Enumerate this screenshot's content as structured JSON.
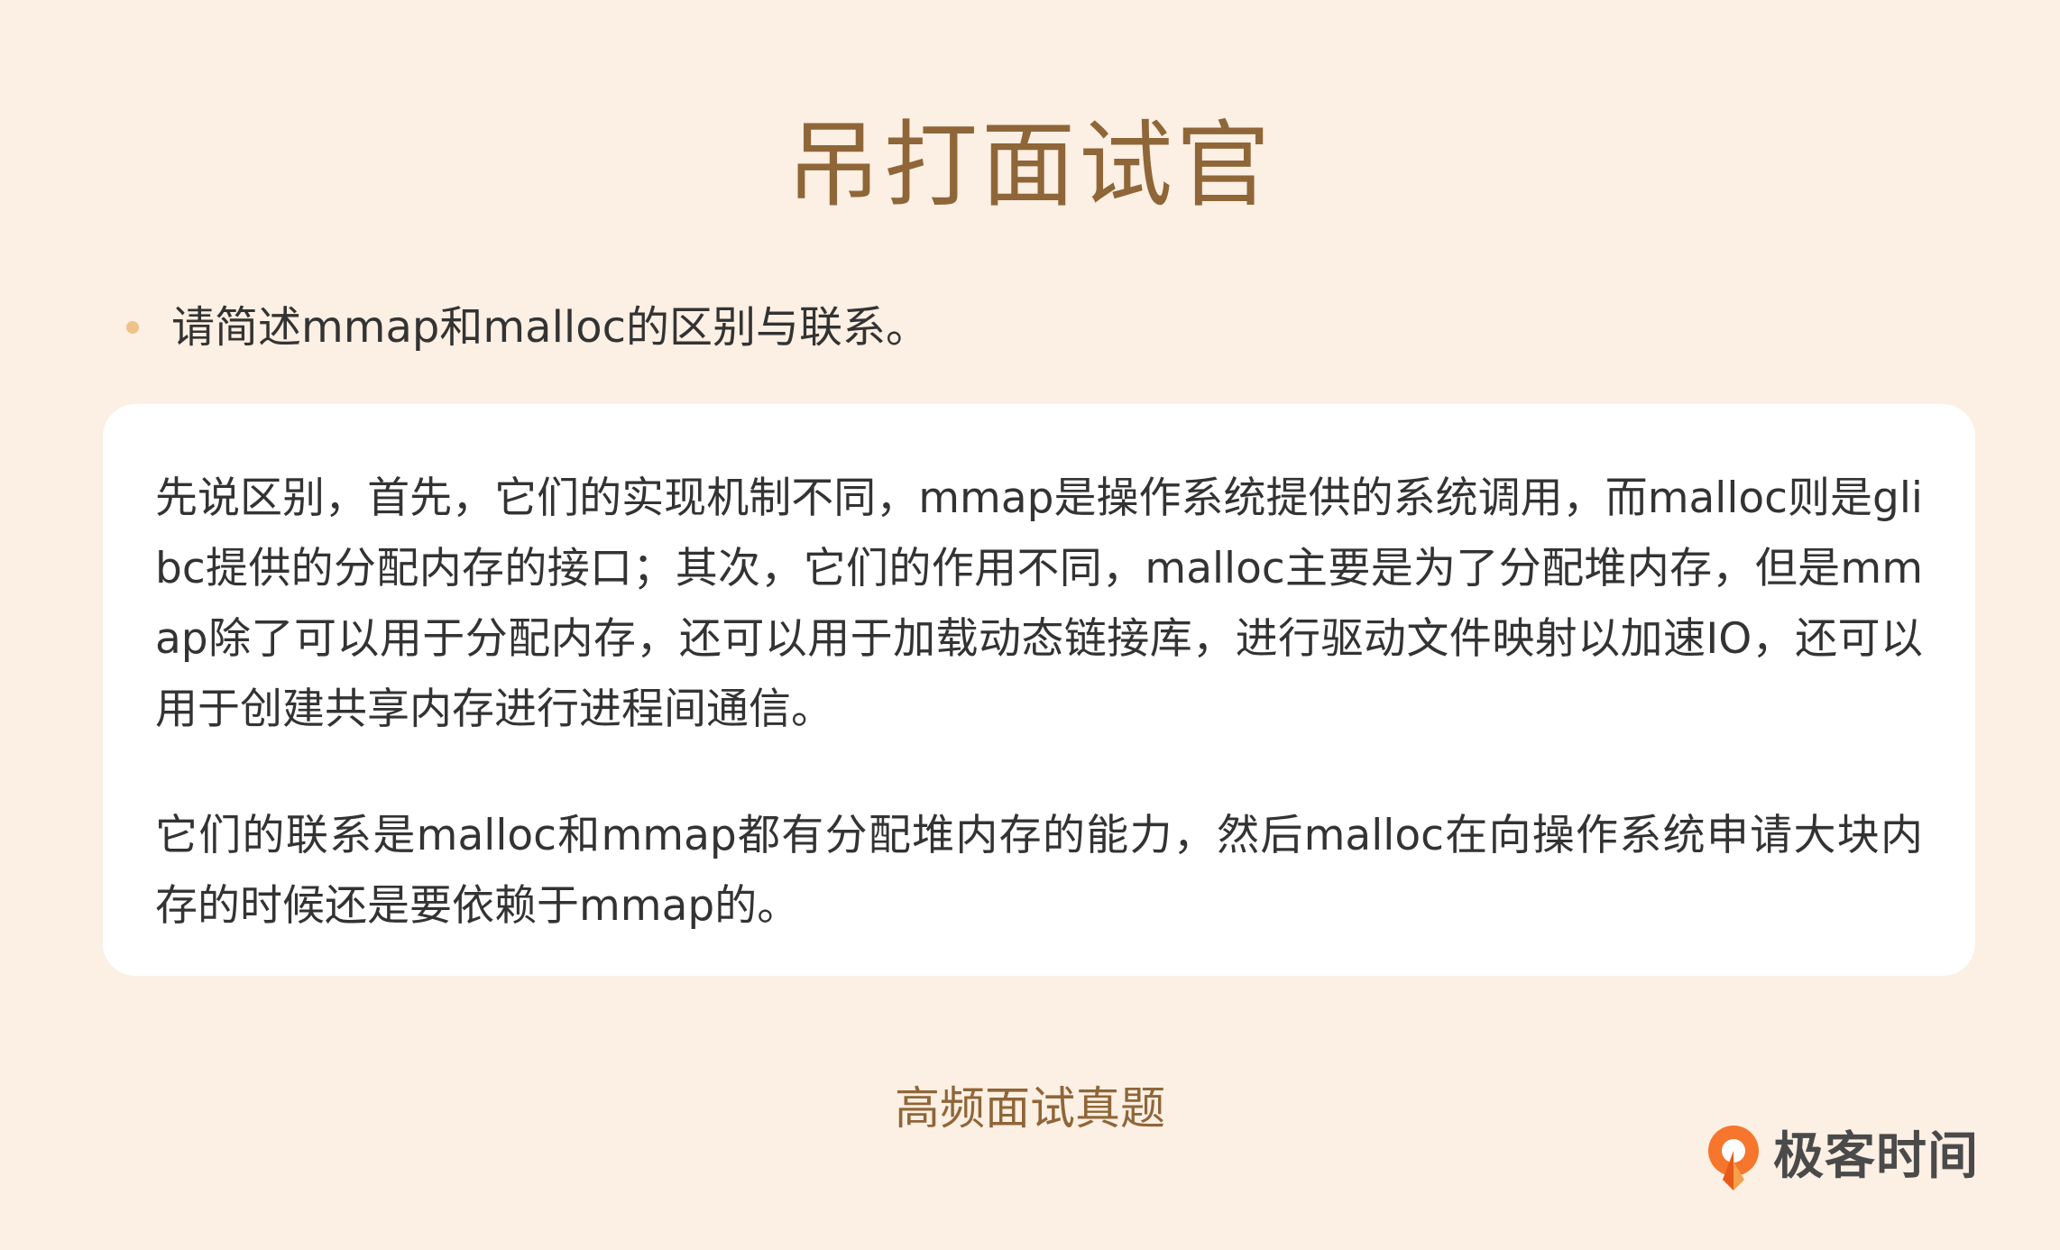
{
  "header": {
    "title": "吊打面试官"
  },
  "question": {
    "text": "请简述mmap和malloc的区别与联系。"
  },
  "answer": {
    "paragraphs": [
      "先说区别，首先，它们的实现机制不同，mmap是操作系统提供的系统调用，而malloc则是glibc提供的分配内存的接口；其次，它们的作用不同，malloc主要是为了分配堆内存，但是mmap除了可以用于分配内存，还可以用于加载动态链接库，进行驱动文件映射以加速IO，还可以用于创建共享内存进行进程间通信。",
      "它们的联系是malloc和mmap都有分配堆内存的能力，然后malloc在向操作系统申请大块内存的时候还是要依赖于mmap的。"
    ]
  },
  "footer": {
    "text": "高频面试真题"
  },
  "brand": {
    "name": "极客时间",
    "icon": "geektime-logo-icon"
  },
  "colors": {
    "background": "#fcefe3",
    "accent": "#8f6638",
    "bullet": "#f0c188",
    "logo_orange": "#f5762c"
  }
}
